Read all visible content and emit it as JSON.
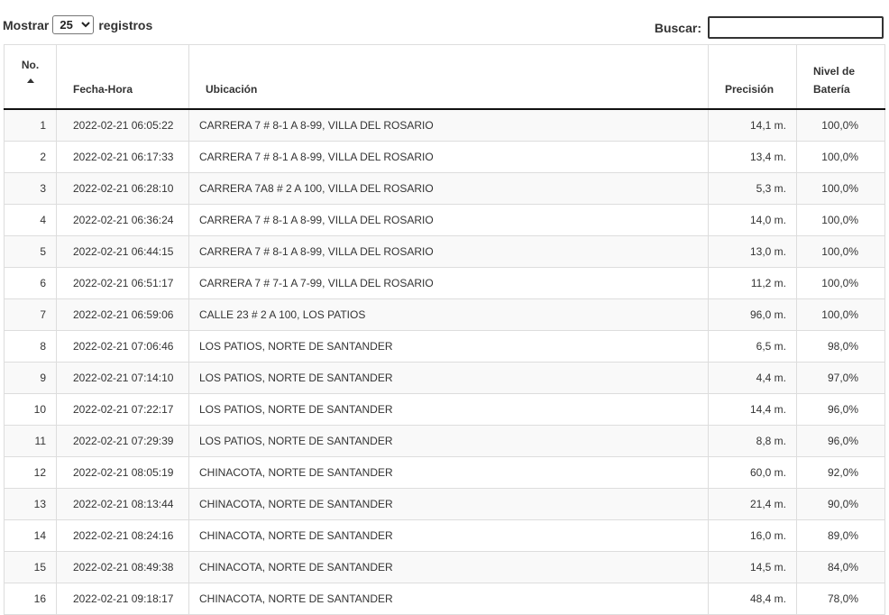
{
  "controls": {
    "show_label": "Mostrar",
    "page_size": "25",
    "records_label": "registros",
    "search_label": "Buscar:",
    "search_value": ""
  },
  "columns": {
    "no": "No.",
    "datetime": "Fecha-Hora",
    "location": "Ubicación",
    "precision": "Precisión",
    "battery_line1": "Nivel de",
    "battery_line2": "Batería"
  },
  "rows": [
    {
      "no": "1",
      "datetime": "2022-02-21 06:05:22",
      "location": "CARRERA 7 # 8-1 A 8-99, VILLA DEL ROSARIO",
      "precision": "14,1 m.",
      "battery": "100,0%"
    },
    {
      "no": "2",
      "datetime": "2022-02-21 06:17:33",
      "location": "CARRERA 7 # 8-1 A 8-99, VILLA DEL ROSARIO",
      "precision": "13,4 m.",
      "battery": "100,0%"
    },
    {
      "no": "3",
      "datetime": "2022-02-21 06:28:10",
      "location": "CARRERA 7A8 # 2 A 100, VILLA DEL ROSARIO",
      "precision": "5,3 m.",
      "battery": "100,0%"
    },
    {
      "no": "4",
      "datetime": "2022-02-21 06:36:24",
      "location": "CARRERA 7 # 8-1 A 8-99, VILLA DEL ROSARIO",
      "precision": "14,0 m.",
      "battery": "100,0%"
    },
    {
      "no": "5",
      "datetime": "2022-02-21 06:44:15",
      "location": "CARRERA 7 # 8-1 A 8-99, VILLA DEL ROSARIO",
      "precision": "13,0 m.",
      "battery": "100,0%"
    },
    {
      "no": "6",
      "datetime": "2022-02-21 06:51:17",
      "location": "CARRERA 7 # 7-1 A 7-99, VILLA DEL ROSARIO",
      "precision": "11,2 m.",
      "battery": "100,0%"
    },
    {
      "no": "7",
      "datetime": "2022-02-21 06:59:06",
      "location": "CALLE 23 # 2 A 100, LOS PATIOS",
      "precision": "96,0 m.",
      "battery": "100,0%"
    },
    {
      "no": "8",
      "datetime": "2022-02-21 07:06:46",
      "location": "LOS PATIOS, NORTE DE SANTANDER",
      "precision": "6,5 m.",
      "battery": "98,0%"
    },
    {
      "no": "9",
      "datetime": "2022-02-21 07:14:10",
      "location": "LOS PATIOS, NORTE DE SANTANDER",
      "precision": "4,4 m.",
      "battery": "97,0%"
    },
    {
      "no": "10",
      "datetime": "2022-02-21 07:22:17",
      "location": "LOS PATIOS, NORTE DE SANTANDER",
      "precision": "14,4 m.",
      "battery": "96,0%"
    },
    {
      "no": "11",
      "datetime": "2022-02-21 07:29:39",
      "location": "LOS PATIOS, NORTE DE SANTANDER",
      "precision": "8,8 m.",
      "battery": "96,0%"
    },
    {
      "no": "12",
      "datetime": "2022-02-21 08:05:19",
      "location": "CHINACOTA, NORTE DE SANTANDER",
      "precision": "60,0 m.",
      "battery": "92,0%"
    },
    {
      "no": "13",
      "datetime": "2022-02-21 08:13:44",
      "location": "CHINACOTA, NORTE DE SANTANDER",
      "precision": "21,4 m.",
      "battery": "90,0%"
    },
    {
      "no": "14",
      "datetime": "2022-02-21 08:24:16",
      "location": "CHINACOTA, NORTE DE SANTANDER",
      "precision": "16,0 m.",
      "battery": "89,0%"
    },
    {
      "no": "15",
      "datetime": "2022-02-21 08:49:38",
      "location": "CHINACOTA, NORTE DE SANTANDER",
      "precision": "14,5 m.",
      "battery": "84,0%"
    },
    {
      "no": "16",
      "datetime": "2022-02-21 09:18:17",
      "location": "CHINACOTA, NORTE DE SANTANDER",
      "precision": "48,4 m.",
      "battery": "78,0%"
    }
  ]
}
